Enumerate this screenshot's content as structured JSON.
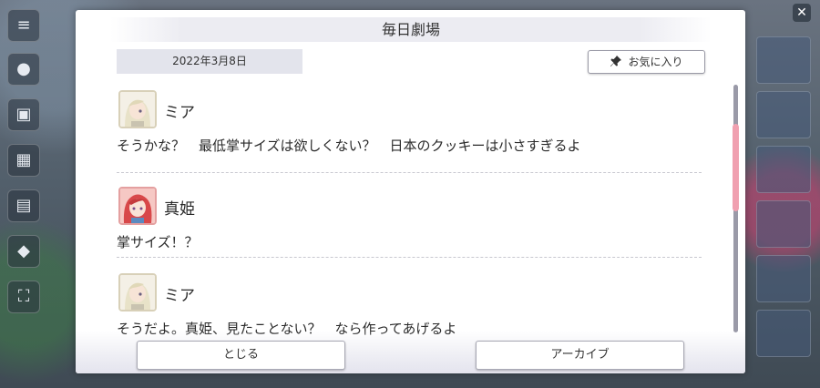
{
  "modal": {
    "title": "毎日劇場",
    "date": "2022年3月8日",
    "favorite_label": "お気に入り"
  },
  "messages": [
    {
      "speaker": "ミア",
      "text": "そうかな？　最低掌サイズは欲しくない？　日本のクッキーは小さすぎるよ",
      "avatar_icon": "mia-portrait-icon"
    },
    {
      "speaker": "真姫",
      "text": "掌サイズ！？",
      "avatar_icon": "maki-portrait-icon"
    },
    {
      "speaker": "ミア",
      "text": "そうだよ。真姫、見たことない？　なら作ってあげるよ",
      "avatar_icon": "mia-portrait-icon"
    }
  ],
  "footer": {
    "close_label": "とじる",
    "archive_label": "アーカイブ"
  },
  "colors": {
    "scroll_thumb": "#f0a0b0",
    "date_bg": "#e3e4ec"
  }
}
